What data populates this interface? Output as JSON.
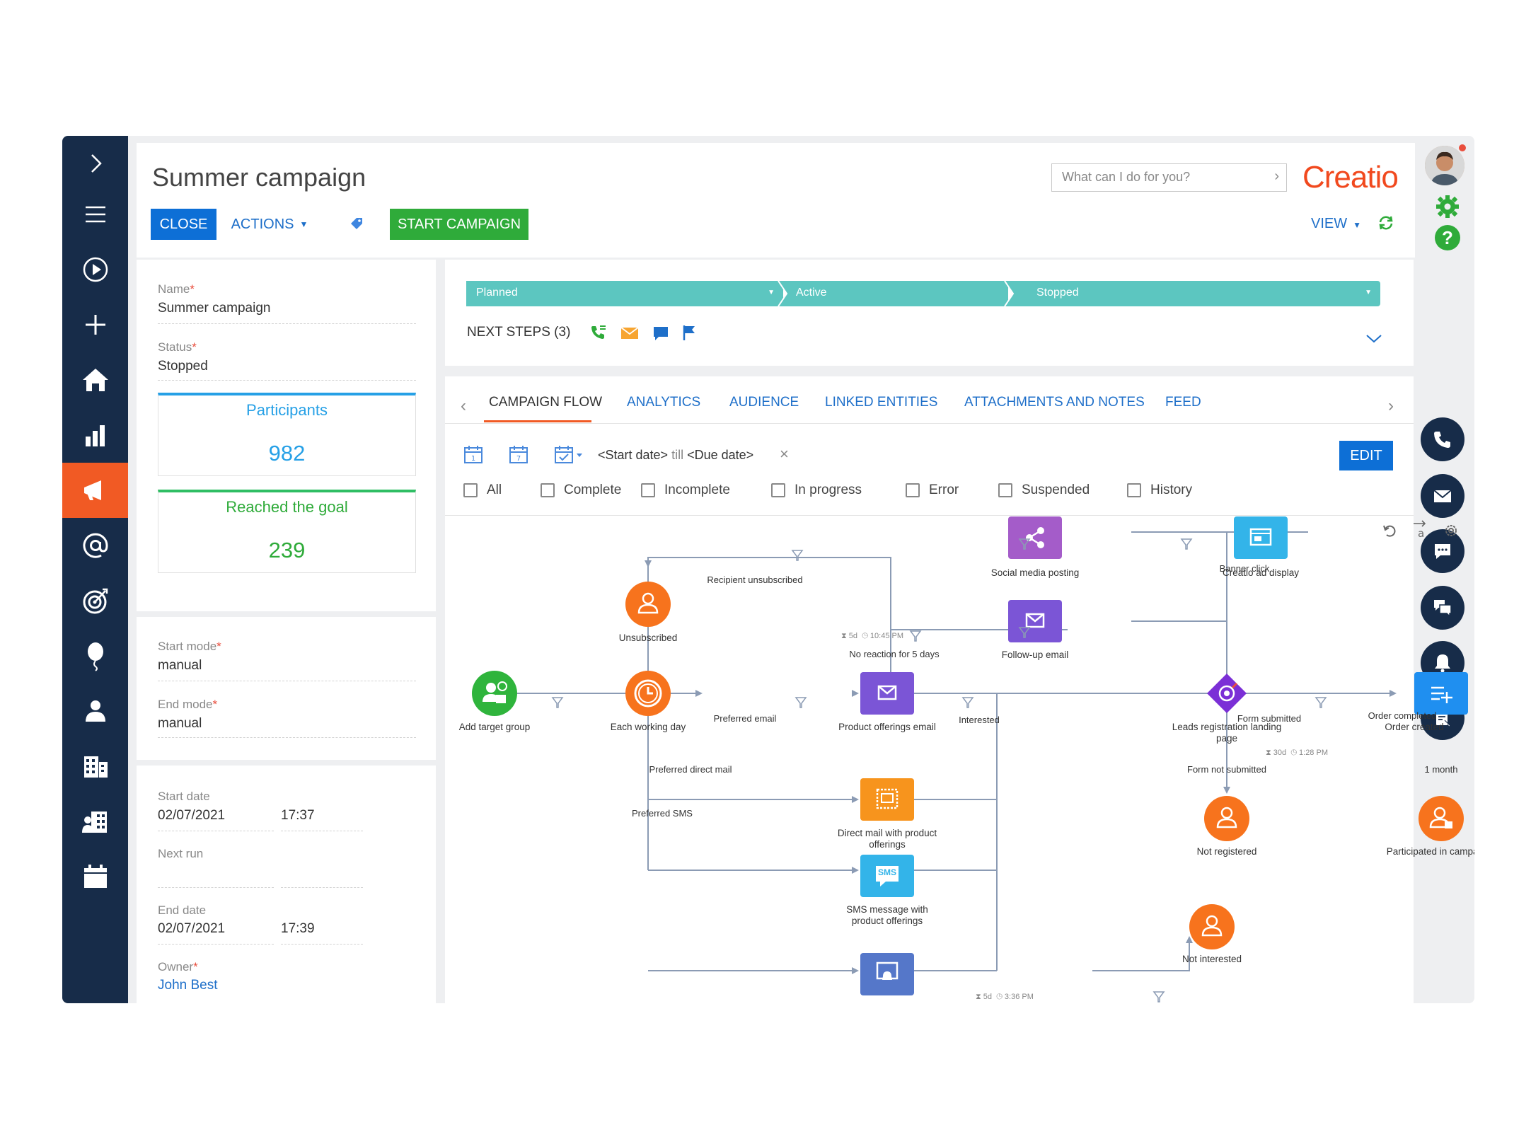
{
  "page": {
    "title": "Summer campaign",
    "close_label": "CLOSE",
    "actions_label": "ACTIONS",
    "start_label": "START CAMPAIGN",
    "search_placeholder": "What can I do for you?",
    "logo": "Creatio",
    "view_label": "VIEW"
  },
  "fields": {
    "name_label": "Name",
    "name_value": "Summer campaign",
    "status_label": "Status",
    "status_value": "Stopped",
    "participants_label": "Participants",
    "participants_value": "982",
    "goal_label": "Reached the goal",
    "goal_value": "239",
    "start_mode_label": "Start mode",
    "start_mode_value": "manual",
    "end_mode_label": "End mode",
    "end_mode_value": "manual",
    "start_date_label": "Start date",
    "start_date_value": "02/07/2021",
    "start_time_value": "17:37",
    "next_run_label": "Next run",
    "end_date_label": "End date",
    "end_date_value": "02/07/2021",
    "end_time_value": "17:39",
    "owner_label": "Owner",
    "owner_value": "John Best"
  },
  "stages": [
    "Planned",
    "Active",
    "Stopped"
  ],
  "next_steps": "NEXT STEPS (3)",
  "tabs": [
    "CAMPAIGN FLOW",
    "ANALYTICS",
    "AUDIENCE",
    "LINKED ENTITIES",
    "ATTACHMENTS AND NOTES",
    "FEED"
  ],
  "filter": {
    "start": "<Start date>",
    "till": "till",
    "due": "<Due date>",
    "edit_label": "EDIT",
    "checkboxes": [
      "All",
      "Complete",
      "Incomplete",
      "In progress",
      "Error",
      "Suspended",
      "History"
    ]
  },
  "flow": {
    "nodes": {
      "add_target": "Add target group",
      "each_day": "Each working day",
      "unsubscribed": "Unsubscribed",
      "product_email": "Product offerings email",
      "social": "Social media posting",
      "ad_display": "Creatio ad display",
      "followup": "Follow-up email",
      "landing": "Leads registration landing page",
      "order": "Order created",
      "direct_mail": "Direct mail with product offerings",
      "sms": "SMS message with product offerings",
      "not_registered": "Not registered",
      "participated": "Participated in campaigns",
      "not_interested": "Not interested"
    },
    "edges": {
      "recipient_unsub": "Recipient unsubscribed",
      "preferred_email": "Preferred email",
      "preferred_mail": "Preferred direct mail",
      "preferred_sms": "Preferred SMS",
      "no_reaction": "No reaction for 5 days",
      "interested": "Interested",
      "banner_click": "Banner click",
      "form_submitted": "Form submitted",
      "form_not_submitted": "Form not submitted",
      "order_completed": "Order completed",
      "one_month": "1 month",
      "timer1_days": "5d",
      "timer1_time": "10:45 PM",
      "timer2_days": "30d",
      "timer2_time": "1:28 PM",
      "timer3_days": "5d",
      "timer3_time": "3:36 PM"
    },
    "sms_badge": "SMS"
  },
  "colors": {
    "nav": "#172c49",
    "accent": "#f15a24",
    "blue": "#0d6fd6",
    "green": "#2fab3a",
    "teal": "#5cc6c0",
    "purple": "#7b4fd6",
    "orange": "#f7941d"
  }
}
